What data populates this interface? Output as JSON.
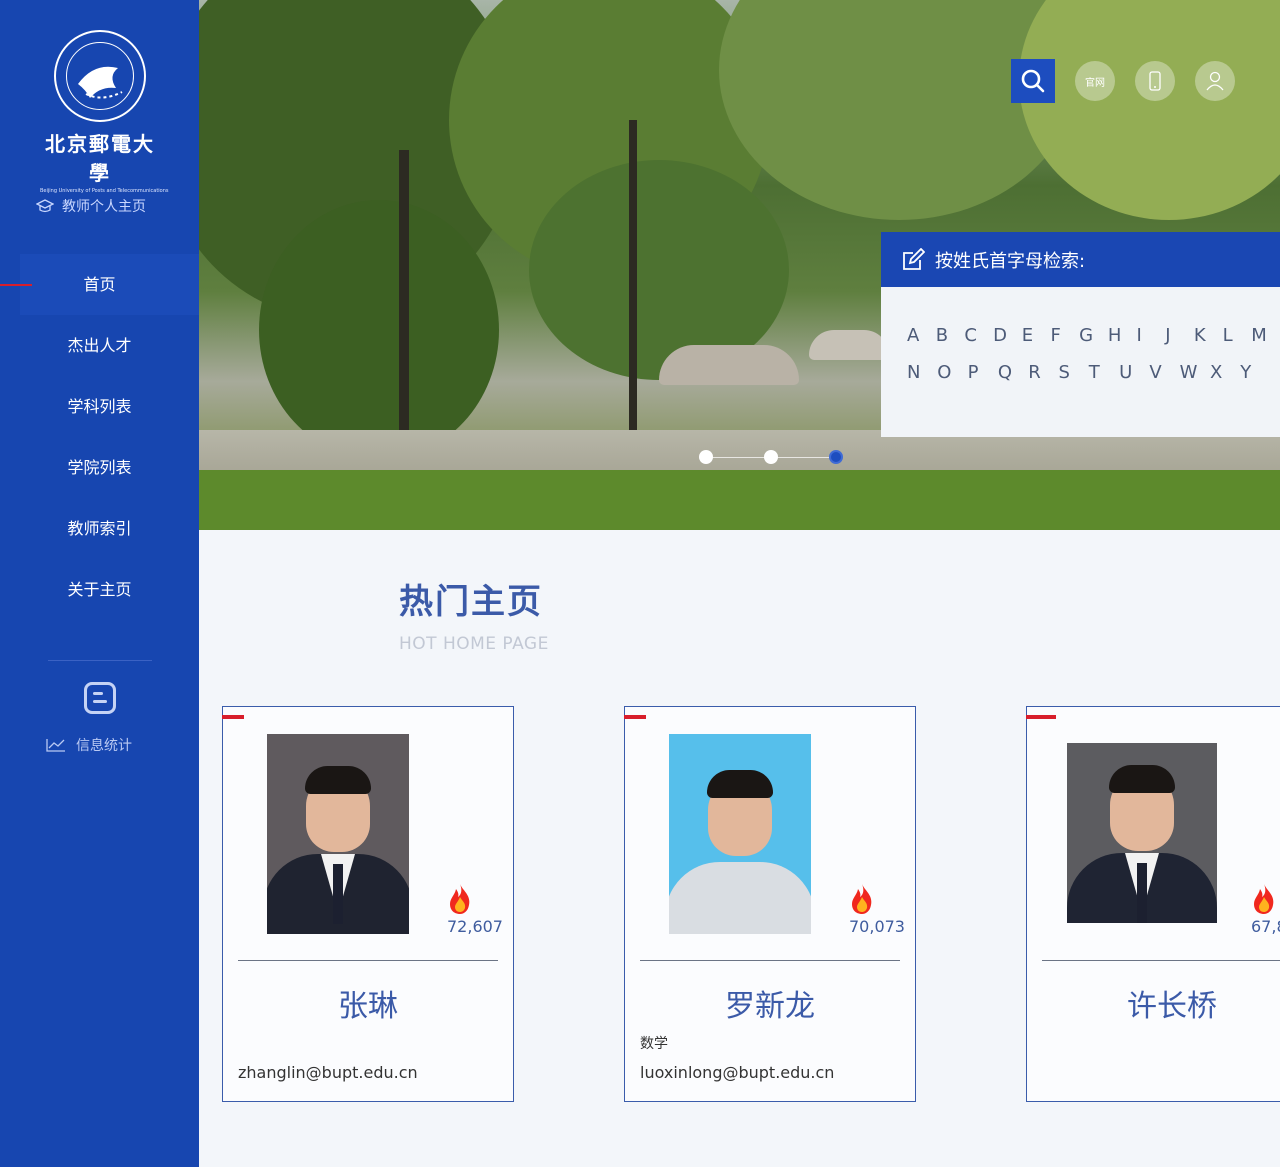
{
  "sidebar": {
    "logo_name": "北京郵電大學",
    "logo_en": "Beijing University of Posts and Telecommunications",
    "subtitle": "教师个人主页",
    "nav": [
      {
        "label": "首页",
        "active": true
      },
      {
        "label": "杰出人才"
      },
      {
        "label": "学科列表"
      },
      {
        "label": "学院列表"
      },
      {
        "label": "教师索引"
      },
      {
        "label": "关于主页"
      }
    ],
    "stats_label": "信息统计"
  },
  "header": {
    "official_site_label": "官网",
    "icons": [
      "search-icon",
      "official-site-icon",
      "mobile-icon",
      "user-icon"
    ]
  },
  "carousel": {
    "slide_count": 3,
    "active_index": 2
  },
  "letter_search": {
    "title": "按姓氏首字母检索:",
    "row1": [
      "A",
      "B",
      "C",
      "D",
      "E",
      "F",
      "G",
      "H",
      "I",
      "J",
      "K",
      "L",
      "M"
    ],
    "row2": [
      "N",
      "O",
      "P",
      "Q",
      "R",
      "S",
      "T",
      "U",
      "V",
      "W",
      "X",
      "Y"
    ]
  },
  "hot": {
    "title": "热门主页",
    "subtitle": "HOT HOME PAGE",
    "cards": [
      {
        "name": "张琳",
        "hits": "72,607",
        "dept": "",
        "email": "zhanglin@bupt.edu.cn"
      },
      {
        "name": "罗新龙",
        "hits": "70,073",
        "dept": "数学",
        "email": "luoxinlong@bupt.edu.cn"
      },
      {
        "name": "许长桥",
        "hits": "67,8",
        "dept": "",
        "email": ""
      }
    ]
  },
  "colors": {
    "primary": "#1746b0",
    "accent_red": "#d81e2b",
    "title_blue": "#3b5aa8"
  }
}
